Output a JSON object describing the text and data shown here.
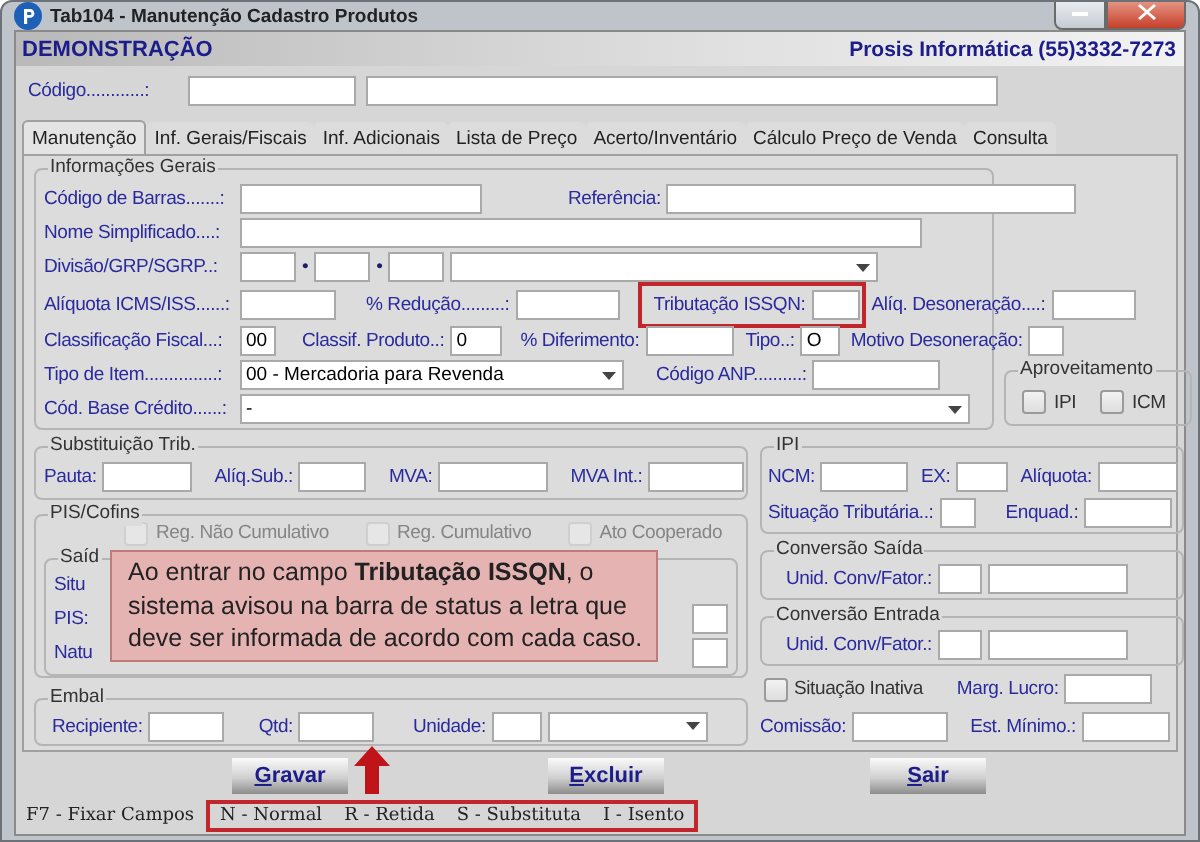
{
  "window": {
    "title": "Tab104 - Manutenção Cadastro Produtos"
  },
  "header": {
    "company": "DEMONSTRAÇÃO",
    "contact": "Prosis Informática (55)3332-7273"
  },
  "code": {
    "label": "Código............:"
  },
  "tabs": [
    {
      "label": "Manutenção",
      "selected": true
    },
    {
      "label": "Inf. Gerais/Fiscais",
      "selected": false
    },
    {
      "label": "Inf. Adicionais",
      "selected": false
    },
    {
      "label": "Lista de Preço",
      "selected": false
    },
    {
      "label": "Acerto/Inventário",
      "selected": false
    },
    {
      "label": "Cálculo Preço de Venda",
      "selected": false
    },
    {
      "label": "Consulta",
      "selected": false
    }
  ],
  "general": {
    "title": "Informações Gerais",
    "barcode": {
      "label": "Código de Barras.......:"
    },
    "reference": {
      "label": "Referência:"
    },
    "short_name": {
      "label": "Nome Simplificado....:"
    },
    "division": {
      "label": "Divisão/GRP/SGRP..:",
      "separators": [
        "•",
        "•"
      ]
    },
    "icms_rate": {
      "label": "Alíquota ICMS/ISS......:"
    },
    "reduction": {
      "label": "% Redução.........:"
    },
    "issqn": {
      "label": "Tributação ISSQN:",
      "highlighted": true
    },
    "relief_rate": {
      "label": "Alíq. Desoneração....:"
    },
    "fiscal_class": {
      "label": "Classificação Fiscal...:",
      "value": "00"
    },
    "product_class": {
      "label": "Classif. Produto..:",
      "value": "0"
    },
    "deferral": {
      "label": "% Diferimento:"
    },
    "type": {
      "label": "Tipo..:",
      "value": "O"
    },
    "relief_reason": {
      "label": "Motivo Desoneração:"
    },
    "item_type": {
      "label": "Tipo de Item...............:",
      "value": "00 - Mercadoria para Revenda"
    },
    "anp": {
      "label": "Código ANP..........:"
    },
    "credit_base": {
      "label": "Cód. Base Crédito......:",
      "value": "-"
    }
  },
  "credit_use": {
    "title": "Aproveitamento",
    "options": [
      {
        "label": "IPI",
        "checked": false
      },
      {
        "label": "ICM",
        "checked": false
      }
    ]
  },
  "tax_substitution": {
    "title": "Substituição Trib.",
    "fields": [
      {
        "label": "Pauta:"
      },
      {
        "label": "Alíq.Sub.:"
      },
      {
        "label": "MVA:"
      },
      {
        "label": "MVA Int.:"
      }
    ]
  },
  "pis_cofins": {
    "title": "PIS/Cofins",
    "options": [
      {
        "label": "Reg. Não Cumulativo",
        "checked": false,
        "disabled": true
      },
      {
        "label": "Reg. Cumulativo",
        "checked": false,
        "disabled": true
      },
      {
        "label": "Ato Cooperado",
        "checked": false,
        "disabled": true
      }
    ],
    "outflow": {
      "title": "Saíd",
      "labels": [
        "Situ",
        "PIS:",
        "Natu"
      ]
    }
  },
  "packaging": {
    "title": "Embal",
    "fields": [
      {
        "label": "Recipiente:"
      },
      {
        "label": "Qtd:"
      },
      {
        "label": "Unidade:"
      }
    ]
  },
  "ipi": {
    "title": "IPI",
    "ncm": {
      "label": "NCM:"
    },
    "ex": {
      "label": "EX:"
    },
    "rate": {
      "label": "Alíquota:"
    },
    "tax_status": {
      "label": "Situação Tributária..:"
    },
    "framing": {
      "label": "Enquad.:"
    }
  },
  "conversion_out": {
    "title": "Conversão Saída",
    "label": "Unid. Conv/Fator.:"
  },
  "conversion_in": {
    "title": "Conversão Entrada",
    "label": "Unid. Conv/Fator.:"
  },
  "inactive": {
    "label": "Situação Inativa",
    "checked": false
  },
  "profit_margin": {
    "label": "Marg. Lucro:"
  },
  "commission": {
    "label": "Comissão:"
  },
  "min_stock": {
    "label": "Est. Mínimo.:"
  },
  "buttons": [
    {
      "label": "Gravar"
    },
    {
      "label": "Excluir"
    },
    {
      "label": "Sair"
    }
  ],
  "status_bar": {
    "shortcut": "F7 - Fixar Campos",
    "hints": [
      "N - Normal",
      "R - Retida",
      "S - Substituta",
      "I - Isento"
    ],
    "hints_highlighted": true
  },
  "callout": {
    "text": "Ao entrar no campo **Tributação ISSQN**, o sistema avisou na barra de status a letra que deve ser informada de acordo com cada caso."
  }
}
